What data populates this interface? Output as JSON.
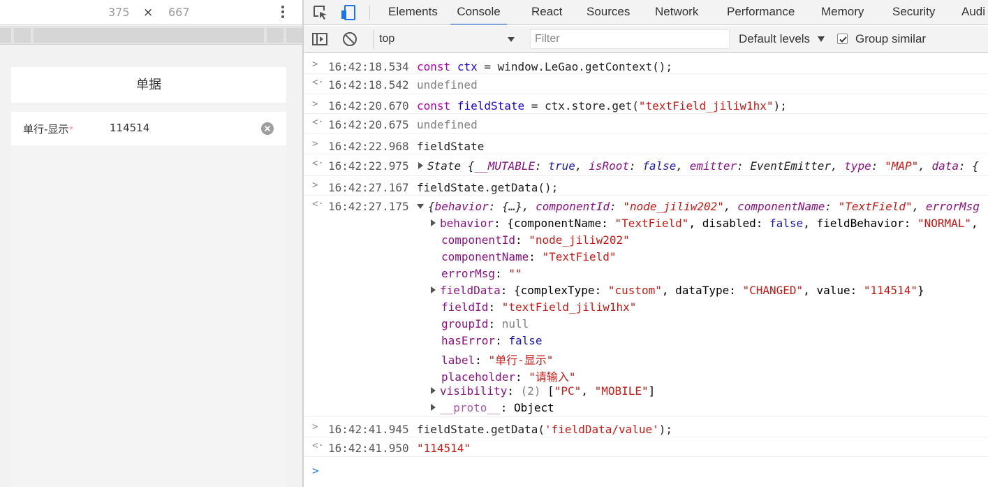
{
  "device": {
    "width": "375",
    "times": "×",
    "height": "667",
    "form_title": "单据",
    "field_label": "单行-显示",
    "field_required_mark": "*",
    "field_value": "114514"
  },
  "tabs": [
    "Elements",
    "Console",
    "React",
    "Sources",
    "Network",
    "Performance",
    "Memory",
    "Security",
    "Audi"
  ],
  "toolbar": {
    "context": "top",
    "filter_placeholder": "Filter",
    "levels": "Default levels",
    "group_similar": "Group similar"
  },
  "console": {
    "m1_in_ts": "16:42:18.534",
    "m1_out_ts": "16:42:18.542",
    "m2_in_ts": "16:42:20.670",
    "m2_out_ts": "16:42:20.675",
    "m3_in_ts": "16:42:22.968",
    "m3_out_ts": "16:42:22.975",
    "m4_in_ts": "16:42:27.167",
    "m4_out_ts": "16:42:27.175",
    "m5_in_ts": "16:42:41.945",
    "m5_out_ts": "16:42:41.950",
    "undefined": "undefined",
    "m3_input": "fieldState",
    "m4_input": "fieldState.getData();",
    "m5_out_value": "\"114514\"",
    "tree": {
      "componentId": "\"node_jiliw202\"",
      "componentName": "\"TextField\"",
      "errorMsg": "\"\"",
      "fieldId": "\"textField_jiliw1hx\"",
      "groupId": "null",
      "hasError": "false",
      "label": "\"单行-显示\"",
      "placeholder": "\"请输入\""
    }
  },
  "colors": {
    "accent": "#1a73e8",
    "string": "#c41a16",
    "property": "#881280",
    "keyword_value": "#1a1aa6"
  }
}
